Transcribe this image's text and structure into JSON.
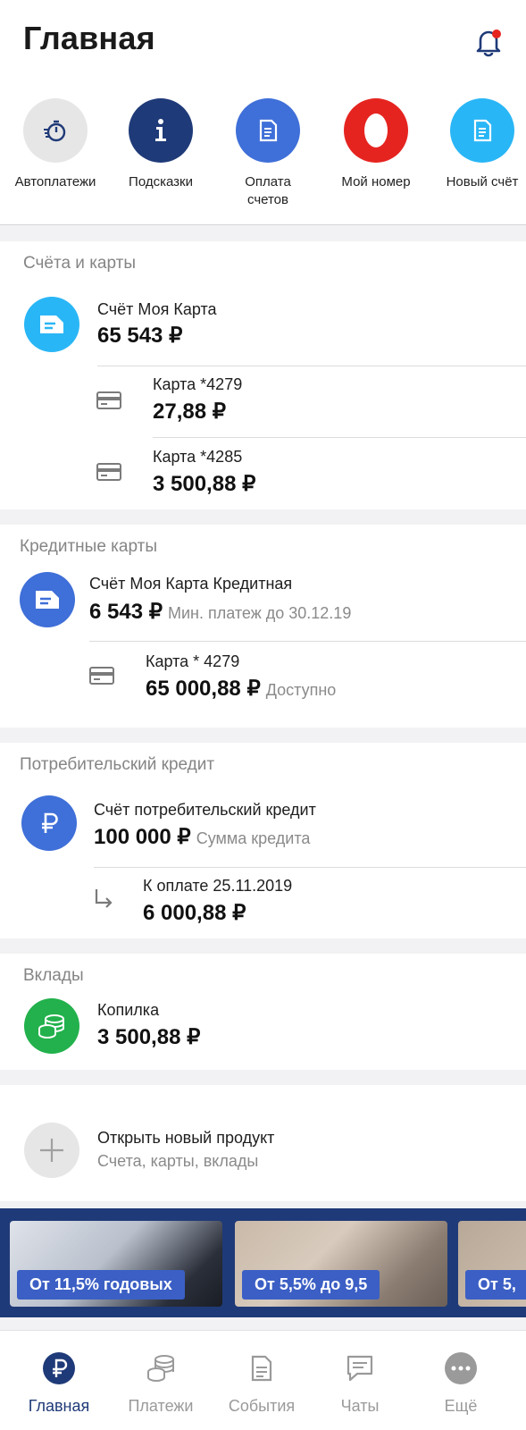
{
  "header": {
    "title": "Главная"
  },
  "shortcuts": [
    {
      "label": "Автоплатежи",
      "icon": "stopwatch-icon",
      "color": "#e6e6e6"
    },
    {
      "label": "Подсказки",
      "icon": "info-icon",
      "color": "#1f3a78"
    },
    {
      "label": "Оплата\nсчетов",
      "icon": "document-icon",
      "color": "#3f6fd8"
    },
    {
      "label": "Мой номер",
      "icon": "operator-logo-icon",
      "color": "#e52420"
    },
    {
      "label": "Новый счёт",
      "icon": "document-icon",
      "color": "#29b6f6"
    }
  ],
  "accounts": {
    "title": "Счёта и карты",
    "main": {
      "name": "Счёт Моя Карта",
      "amount": "65 543 ₽"
    },
    "cards": [
      {
        "name": "Карта *4279",
        "amount": "27,88 ₽"
      },
      {
        "name": "Карта *4285",
        "amount": "3 500,88 ₽"
      }
    ]
  },
  "credit_cards": {
    "title": "Кредитные карты",
    "main": {
      "name": "Счёт Моя Карта Кредитная",
      "amount": "6 543 ₽",
      "note": "Мин. платеж до 30.12.19"
    },
    "card": {
      "name": "Карта * 4279",
      "amount": "65 000,88 ₽",
      "note": "Доступно"
    }
  },
  "consumer_credit": {
    "title": "Потребительский кредит",
    "main": {
      "name": "Счёт потребительский кредит",
      "amount": "100 000 ₽",
      "note": "Сумма кредита"
    },
    "payment": {
      "name": "К оплате 25.11.2019",
      "amount": "6 000,88 ₽"
    }
  },
  "deposits": {
    "title": "Вклады",
    "main": {
      "name": "Копилка",
      "amount": "3 500,88 ₽"
    }
  },
  "new_product": {
    "title": "Открыть новый продукт",
    "subtitle": "Счета, карты, вклады"
  },
  "banners": [
    {
      "label": "От 11,5% годовых"
    },
    {
      "label": "От 5,5% до 9,5"
    },
    {
      "label": "От 5,"
    }
  ],
  "tabs": [
    {
      "label": "Главная",
      "icon": "ruble-icon",
      "active": true
    },
    {
      "label": "Платежи",
      "icon": "coins-icon",
      "active": false
    },
    {
      "label": "События",
      "icon": "document-icon",
      "active": false
    },
    {
      "label": "Чаты",
      "icon": "chat-icon",
      "active": false
    },
    {
      "label": "Ещё",
      "icon": "more-icon",
      "active": false
    }
  ],
  "colors": {
    "brand": "#1f3a78",
    "accent": "#3f6fd8",
    "notification": "#e52420",
    "deposit": "#22b14c"
  }
}
